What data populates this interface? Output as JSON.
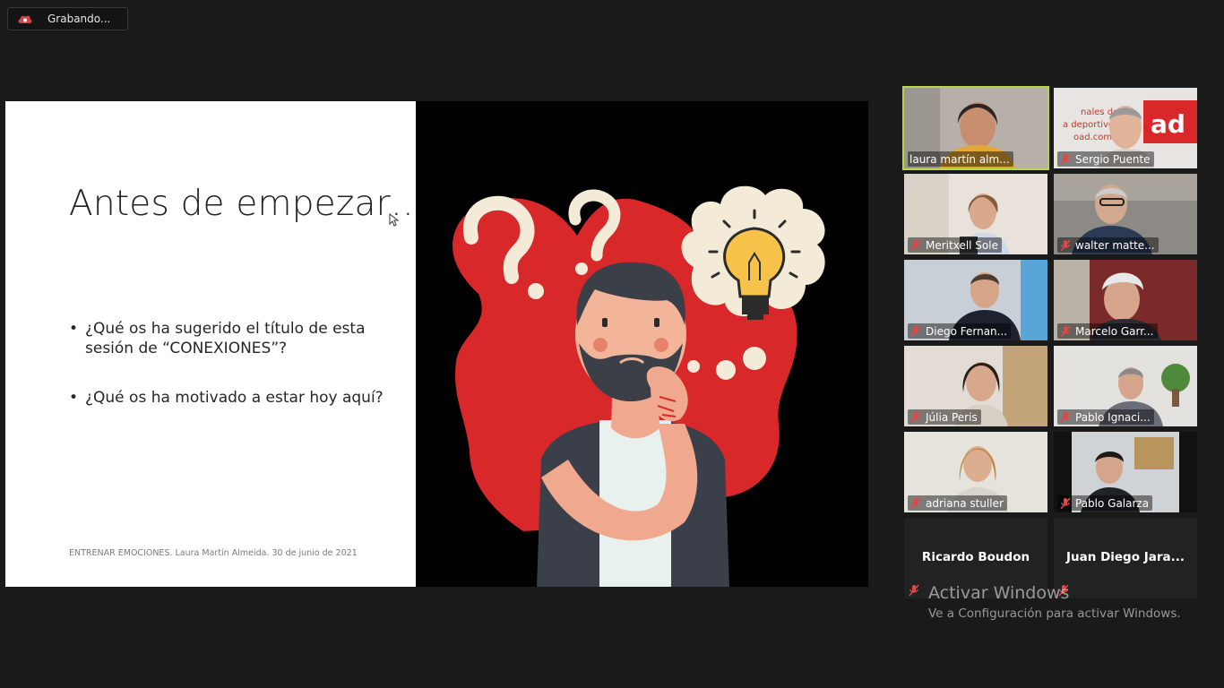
{
  "recording": {
    "label": "Grabando...",
    "icon": "cloud-record-icon",
    "color": "#d9434a"
  },
  "slide": {
    "title": "Antes de empezar…",
    "bullets": [
      "¿Qué os ha sugerido el título de esta sesión de “CONEXIONES”?",
      "¿Qué os ha motivado a estar hoy aquí?"
    ],
    "footer": "ENTRENAR EMOCIONES. Laura Martín Almeida. 30 de junio de 2021",
    "accent": "#d8282a"
  },
  "gallery": {
    "active_color": "#b9d64a",
    "participants": [
      {
        "name": "laura martín alm...",
        "muted": false,
        "active": true
      },
      {
        "name": "Sergio Puente",
        "muted": true
      },
      {
        "name": "Meritxell Sole",
        "muted": true
      },
      {
        "name": "walter matte...",
        "muted": true
      },
      {
        "name": "Diego Fernan...",
        "muted": true
      },
      {
        "name": "Marcelo Garr...",
        "muted": true
      },
      {
        "name": "Júlia Peris",
        "muted": true
      },
      {
        "name": "Pablo Ignaci...",
        "muted": true
      },
      {
        "name": "adriana stuller",
        "muted": true
      },
      {
        "name": "Pablo Galarza",
        "muted": true
      },
      {
        "name": "Ricardo Boudon",
        "muted": true,
        "video_off": true
      },
      {
        "name": "Juan Diego Jara...",
        "muted": true,
        "video_off": true
      }
    ]
  },
  "watermark": {
    "title": "Activar Windows",
    "subtitle": "Ve a Configuración para activar Windows."
  }
}
